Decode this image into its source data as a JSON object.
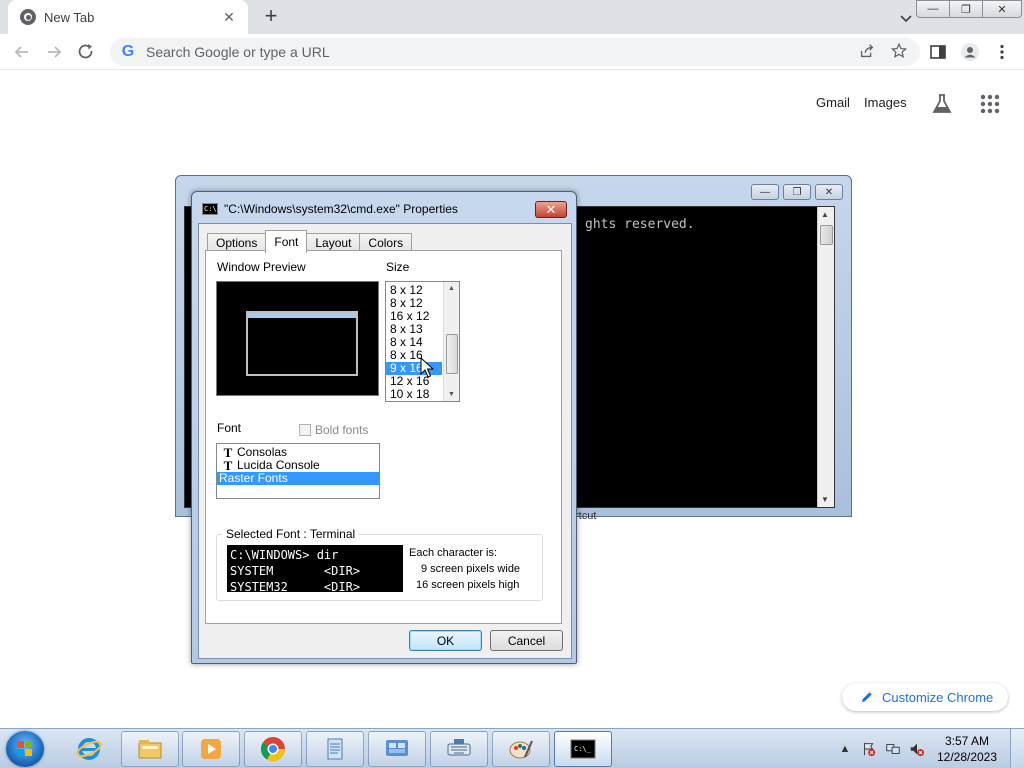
{
  "browser": {
    "tab_title": "New Tab",
    "tab_close_glyph": "✕",
    "new_tab_glyph": "+",
    "omnibox_placeholder": "Search Google or type a URL",
    "omnibox_g": "G"
  },
  "window_controls": {
    "minimize": "—",
    "restore": "❐",
    "close": "✕"
  },
  "ntp": {
    "gmail": "Gmail",
    "images": "Images",
    "customize": "Customize Chrome"
  },
  "cmd_window": {
    "visible_text": "ghts reserved.",
    "under_text": "rtcut"
  },
  "dialog": {
    "title": "\"C:\\Windows\\system32\\cmd.exe\" Properties",
    "close_glyph": "✕",
    "tabs": [
      "Options",
      "Font",
      "Layout",
      "Colors"
    ],
    "active_tab": "Font",
    "window_preview_label": "Window Preview",
    "size_label": "Size",
    "sizes": [
      "8 x 12",
      "8 x 12",
      "16 x 12",
      "8 x 13",
      "8 x 14",
      "8 x 16",
      "9 x 16",
      "12 x 16",
      "10 x 18"
    ],
    "selected_size": "9 x 16",
    "font_label": "Font",
    "bold_fonts_label": "Bold fonts",
    "fonts": [
      "Consolas",
      "Lucida Console",
      "Raster Fonts"
    ],
    "selected_font": "Raster Fonts",
    "selected_font_group": "Selected Font : Terminal",
    "sample_lines": [
      "C:\\WINDOWS> dir",
      "SYSTEM       <DIR>",
      "SYSTEM32     <DIR>"
    ],
    "char_info_title": "Each character is:",
    "char_width": "9 screen pixels wide",
    "char_height": "16 screen pixels high",
    "ok": "OK",
    "cancel": "Cancel"
  },
  "taskbar": {
    "time": "3:57 AM",
    "date": "12/28/2023",
    "apps": [
      "internet-explorer",
      "file-explorer",
      "media-player",
      "chrome",
      "notepad",
      "control-panel",
      "keyboard",
      "paint",
      "command-prompt"
    ]
  }
}
